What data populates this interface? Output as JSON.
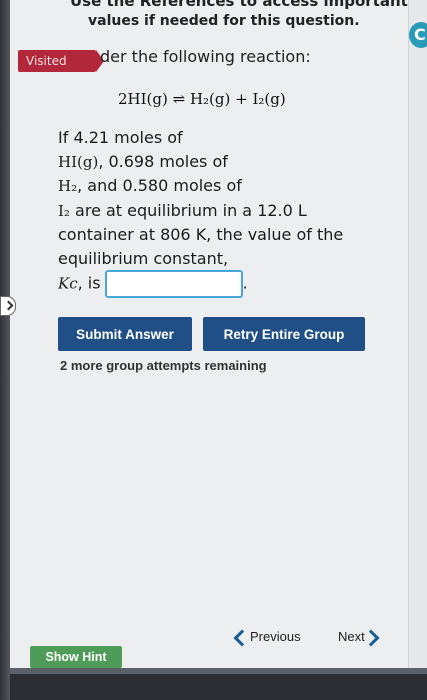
{
  "header": {
    "line1": "Use the References to access important",
    "line2": "values if needed for this question."
  },
  "visited_label": "Visited",
  "question": {
    "intro": "der the following reaction:",
    "reaction": "2HI(g) ⇌ H₂(g) + I₂(g)",
    "line1": "If 4.21 moles of",
    "line2_species": "HI(g)",
    "line2_text": ", 0.698 moles of",
    "line3_species": "H₂",
    "line3_text": ", and 0.580 moles of",
    "line4_species": "I₂",
    "line4_text": " are at equilibrium in a 12.0 L",
    "line5": "container at 806 K, the value of the",
    "line6": "equilibrium constant,",
    "kc_symbol": "Kc",
    "kc_text": ", is",
    "answer_value": "",
    "period": "."
  },
  "buttons": {
    "submit": "Submit Answer",
    "retry": "Retry Entire Group"
  },
  "attempts": "2 more group attempts remaining",
  "nav": {
    "previous": "Previous",
    "next": "Next"
  },
  "hint_label": "Show Hint",
  "colors": {
    "button_bg": "#1f4f86",
    "visited_bg": "#b2283a",
    "hint_bg": "#4f9c58",
    "input_border": "#4aa8d8",
    "nav_chevron": "#1a5d92"
  }
}
